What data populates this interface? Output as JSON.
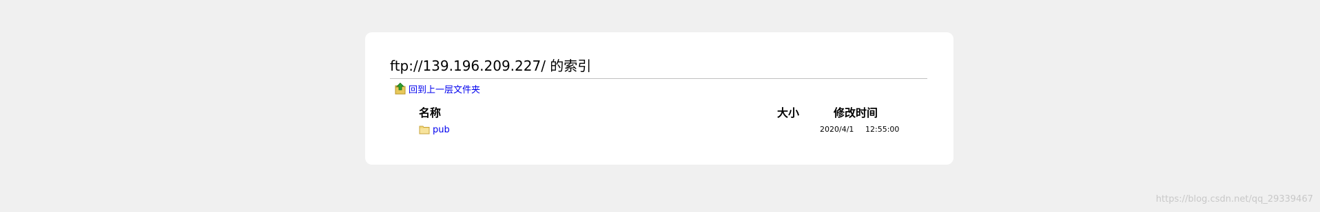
{
  "page": {
    "heading": "ftp://139.196.209.227/ 的索引",
    "up_link_label": "回到上一层文件夹"
  },
  "table": {
    "headers": {
      "name": "名称",
      "size": "大小",
      "modified": "修改时间"
    },
    "rows": [
      {
        "name": "pub",
        "size": "",
        "date": "2020/4/1",
        "time": "12:55:00",
        "icon": "folder-icon"
      }
    ]
  },
  "watermark": "https://blog.csdn.net/qq_29339467",
  "colors": {
    "background": "#f0f0f0",
    "card": "#ffffff",
    "link": "#0000ee",
    "divider": "#c0c0c0"
  },
  "icons": {
    "up": "up-folder-icon",
    "folder": "folder-icon"
  }
}
